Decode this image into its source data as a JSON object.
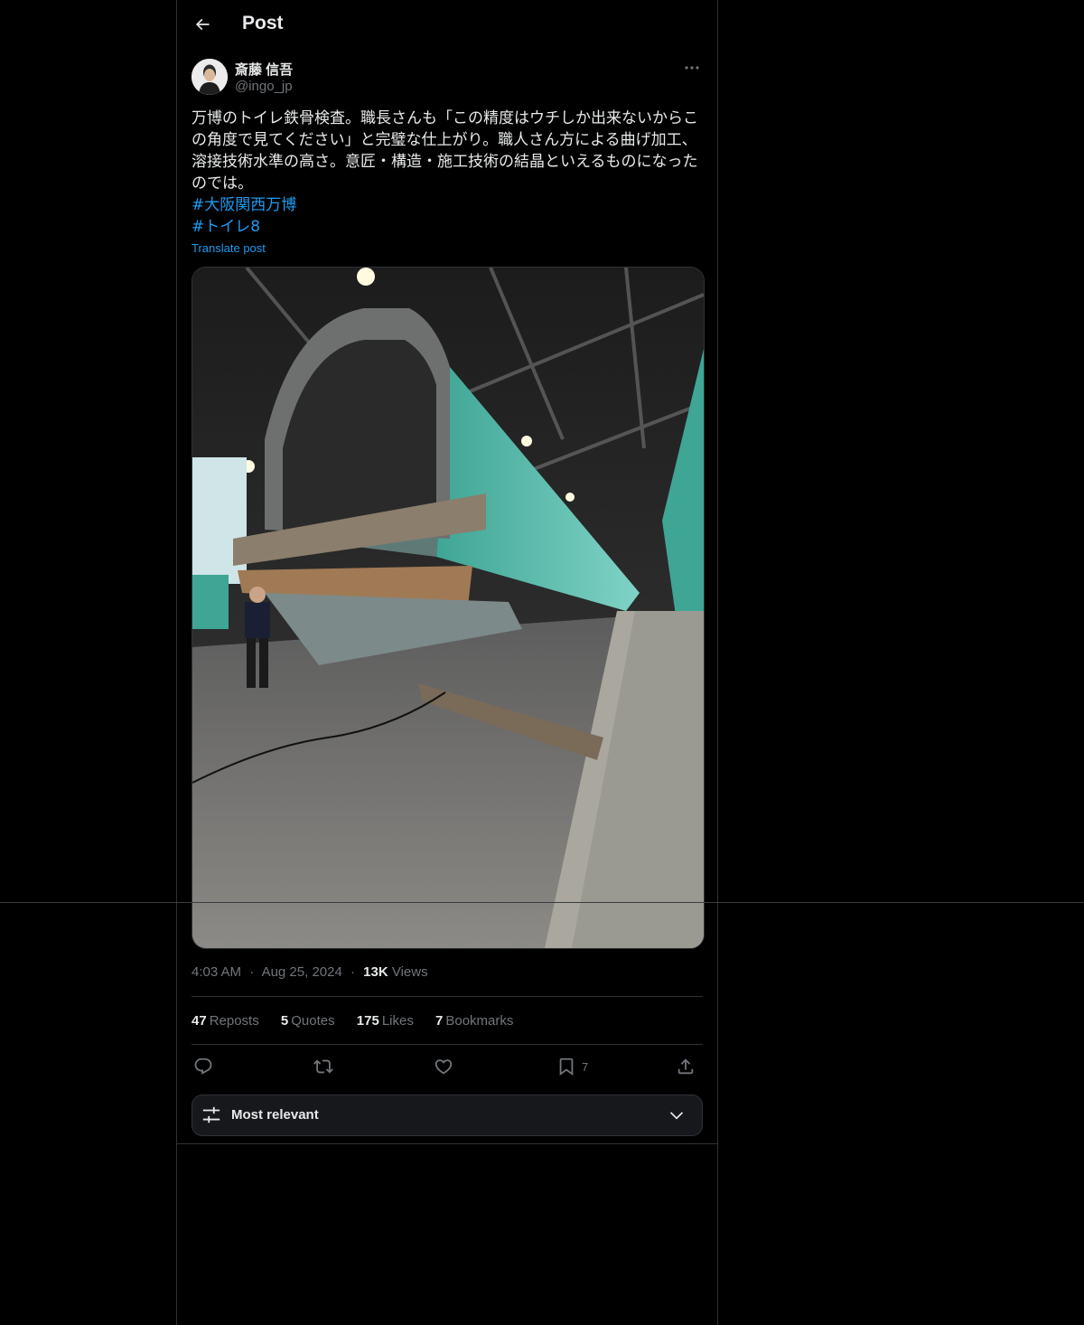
{
  "header": {
    "title": "Post"
  },
  "author": {
    "display_name": "斎藤 信吾",
    "handle": "@ingo_jp"
  },
  "post": {
    "text_lines": [
      "万博のトイレ鉄骨検査。職長さんも「この精度はウチしか出来ないからこ",
      "の角度で見てください」と完璧な仕上がり。職人さん方による曲げ加工、",
      "溶接技術水準の高さ。意匠・構造・施工技術の結晶といえるものになった",
      "のでは。"
    ],
    "hashtags": [
      "#大阪関西万博",
      "#トイレ8"
    ],
    "translate_label": "Translate post"
  },
  "meta": {
    "time": "4:03 AM",
    "date": "Aug 25, 2024",
    "views_count": "13K",
    "views_label": "Views",
    "sep": "·"
  },
  "stats": [
    {
      "count": "47",
      "label": "Reposts"
    },
    {
      "count": "5",
      "label": "Quotes"
    },
    {
      "count": "175",
      "label": "Likes"
    },
    {
      "count": "7",
      "label": "Bookmarks"
    }
  ],
  "actions": {
    "bookmark_count": "7"
  },
  "sort": {
    "label": "Most relevant"
  },
  "colors": {
    "background": "#000000",
    "text": "#e7e9ea",
    "secondary": "#71767b",
    "link": "#1d9bf0",
    "border": "#2f3336",
    "steel_green": "#4ab5a6"
  }
}
